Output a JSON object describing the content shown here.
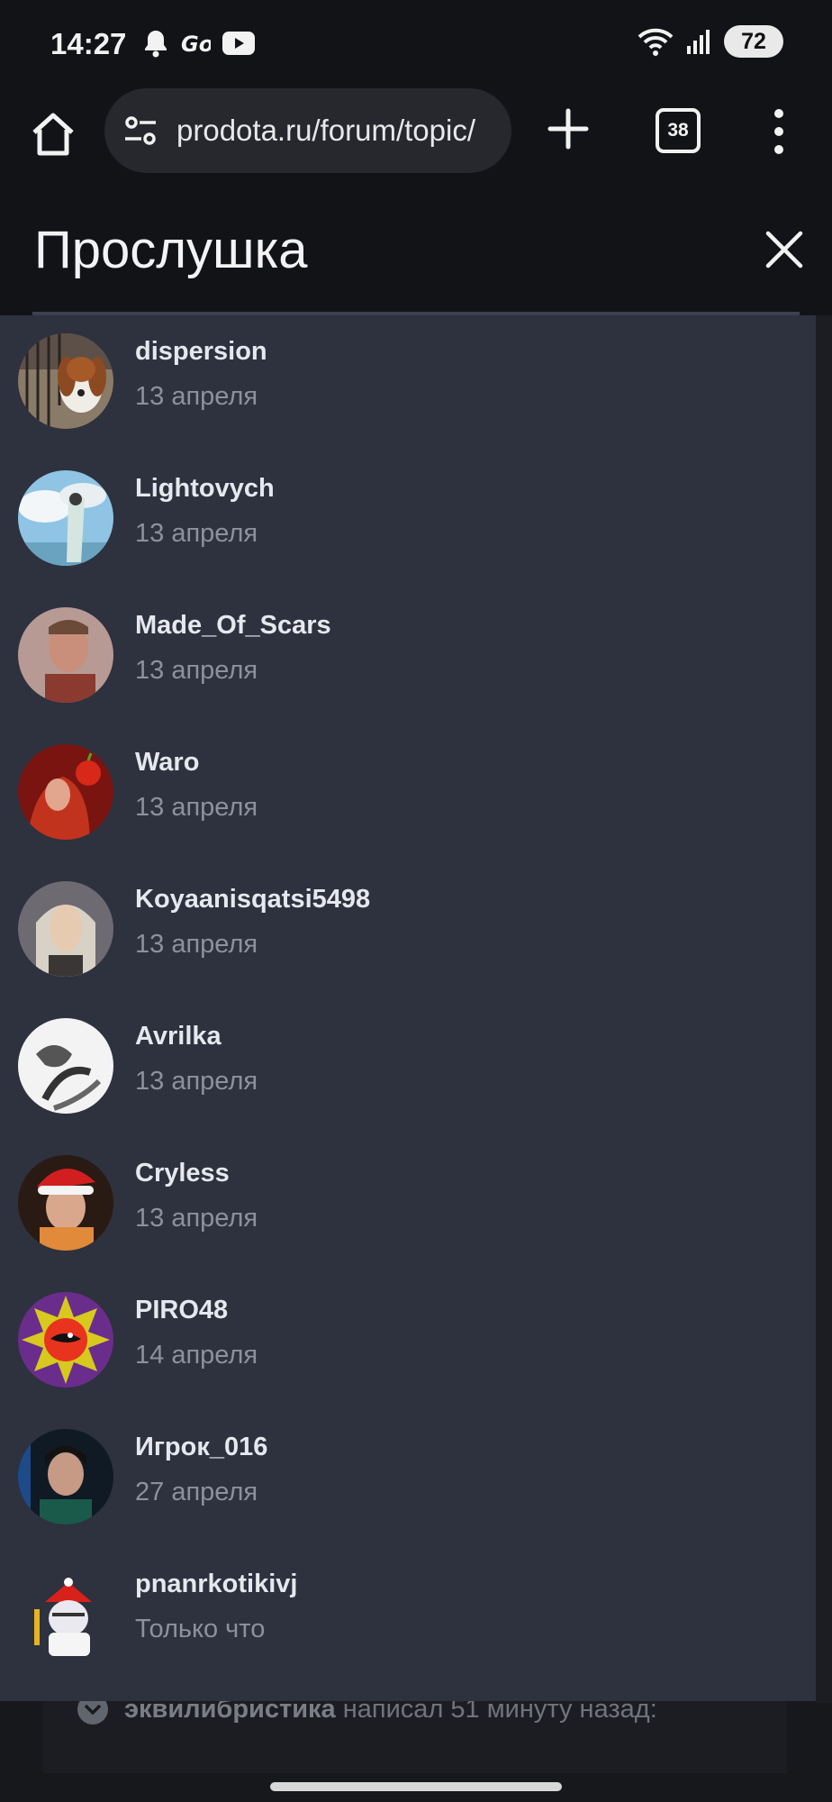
{
  "status_bar": {
    "time": "14:27",
    "battery": "72"
  },
  "browser": {
    "url": "prodota.ru/forum/topic/",
    "tab_count": "38"
  },
  "sheet": {
    "title": "Прослушка"
  },
  "users": [
    {
      "name": "dispersion",
      "date": "13 апреля"
    },
    {
      "name": "Lightovych",
      "date": "13 апреля"
    },
    {
      "name": "Made_Of_Scars",
      "date": "13 апреля"
    },
    {
      "name": "Waro",
      "date": "13 апреля"
    },
    {
      "name": "Koyaanisqatsi5498",
      "date": "13 апреля"
    },
    {
      "name": "Avrilka",
      "date": "13 апреля"
    },
    {
      "name": "Cryless",
      "date": "13 апреля"
    },
    {
      "name": "PIRO48",
      "date": "14 апреля"
    },
    {
      "name": "Игрок_016",
      "date": "27 апреля"
    },
    {
      "name": "pnanrkotikivj",
      "date": "Только что"
    }
  ],
  "background_post": {
    "author": "эквилибристика",
    "text": "написал 51 минуту назад:"
  }
}
